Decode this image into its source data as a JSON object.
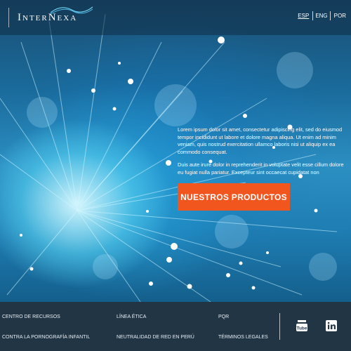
{
  "brand": {
    "name": "InterNexa"
  },
  "languages": [
    {
      "label": "ESP",
      "active": true
    },
    {
      "label": "ENG",
      "active": false
    },
    {
      "label": "POR",
      "active": false
    }
  ],
  "hero": {
    "paragraph1": "Lorem ipsum dolor sit amet, consectetur adipiscing elit, sed do eiusmod tempor incididunt ut labore et dolore magna aliqua. Ut enim ad minim veniam, quis nostrud exercitation ullamco laboris nisi ut aliquip ex ea commodo consequat.",
    "paragraph2": "Duis aute irure dolor in reprehenderit in voluptate velit esse cillum dolore eu fugiat nulla pariatur. Excepteur sint occaecat cupidatat non",
    "cta_label": "NUESTROS PRODUCTOS"
  },
  "colors": {
    "accent": "#f0561e",
    "footer_bg": "#26374a"
  },
  "footer": {
    "links": [
      "CENTRO DE RECURSOS",
      "LÍNEA ÉTICA",
      "PQR",
      "CONTRA LA PORNOGRAFÍA INFANTIL",
      "NEUTRALIDAD DE RED EN PERÚ",
      "TÉRMINOS LEGALES"
    ],
    "social": [
      "youtube-icon",
      "linkedin-icon"
    ]
  }
}
